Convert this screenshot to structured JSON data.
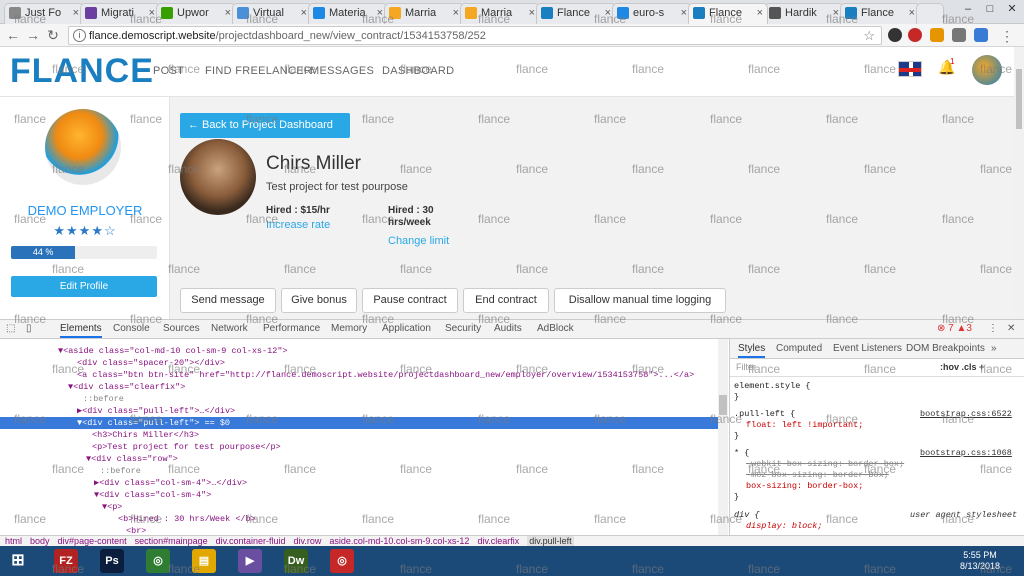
{
  "tabs": [
    {
      "label": "Just Fo",
      "color": "#888"
    },
    {
      "label": "Migrati",
      "color": "#6b3fa0"
    },
    {
      "label": "Upwor",
      "color": "#37a000"
    },
    {
      "label": "Virtual",
      "color": "#4a90d9"
    },
    {
      "label": "Materia",
      "color": "#1e88e5"
    },
    {
      "label": "Marria",
      "color": "#f5a623"
    },
    {
      "label": "Marria",
      "color": "#f5a623"
    },
    {
      "label": "Flance",
      "color": "#1a7fc1"
    },
    {
      "label": "euro-s",
      "color": "#1e88e5"
    },
    {
      "label": "Flance",
      "color": "#1a7fc1"
    },
    {
      "label": "Hardik",
      "color": "#555"
    },
    {
      "label": "Flance",
      "color": "#1a7fc1"
    }
  ],
  "address": {
    "host": "flance.demoscript.website",
    "path": "/projectdashboard_new/view_contract/1534153758/252"
  },
  "site": {
    "logo": "FLANCE",
    "nav": [
      "POST",
      "FIND FREELANCER",
      "MESSAGES",
      "DASHBOARD"
    ],
    "notification_count": "1"
  },
  "sidebar": {
    "name": "DEMO EMPLOYER",
    "stars": "★★★★☆",
    "progress_label": "44 %",
    "progress": 44,
    "edit_profile": "Edit Profile"
  },
  "main": {
    "back_button": "← Back to Project Dashboard",
    "freelancer_name": "Chirs Miller",
    "description": "Test project for test pourpose",
    "hired_rate": "Hired : $15/hr",
    "increase_rate": "Increase rate",
    "hired_hours": "Hired : 30 hrs/week",
    "change_limit": "Change limit",
    "actions": [
      "Send message",
      "Give bonus",
      "Pause contract",
      "End contract",
      "Disallow manual time logging"
    ]
  },
  "devtools": {
    "tabs": [
      "Elements",
      "Console",
      "Sources",
      "Network",
      "Performance",
      "Memory",
      "Application",
      "Security",
      "Audits",
      "AdBlock"
    ],
    "errors": "⊗ 7 ▲3",
    "dom_lines": [
      "▼<aside class=\"col-md-10 col-sm-9 col-xs-12\">",
      "<div class=\"spacer-20\"></div>",
      "<a class=\"btn btn-site\" href=\"http://flance.demoscript.website/projectdashboard_new/employer/overview/1534153758\">...</a>",
      "▼<div class=\"clearfix\">",
      "::before",
      "▶<div class=\"pull-left\">…</div>",
      "▼<div class=\"pull-left\"> == $0",
      "<h3>Chirs Miller</h3>",
      "<p>Test project for test pourpose</p>",
      "▼<div class=\"row\">",
      "::before",
      "▶<div class=\"col-sm-4\">…</div>",
      "▼<div class=\"col-sm-4\">",
      "▼<p>",
      "<b>Hired : 30 hrs/Week </b>",
      "<br>"
    ],
    "styles_tabs": [
      "Styles",
      "Computed",
      "Event Listeners",
      "DOM Breakpoints"
    ],
    "filter_placeholder": "Filter",
    "filter_hov": ":hov  .cls  +",
    "rules": [
      {
        "selector": "element.style {",
        "source": "",
        "props": [
          "}"
        ]
      },
      {
        "selector": ".pull-left {",
        "source": "bootstrap.css:6522",
        "props": [
          "float: left !important;",
          "}"
        ]
      },
      {
        "selector": "* {",
        "source": "bootstrap.css:1068",
        "props": [
          "-webkit-box-sizing: border-box;",
          "-moz-box-sizing: border-box;",
          "box-sizing: border-box;",
          "}"
        ]
      },
      {
        "selector": "div {",
        "source": "user agent stylesheet",
        "props": [
          "display: block;"
        ]
      }
    ],
    "breadcrumb": [
      "html",
      "body",
      "div#page-content",
      "section#mainpage",
      "div.container-fluid",
      "div.row",
      "aside.col-md-10.col-sm-9.col-xs-12",
      "div.clearfix",
      "div.pull-left"
    ]
  },
  "taskbar": {
    "apps": [
      {
        "name": "filezilla",
        "label": "FZ",
        "color": "#b22222"
      },
      {
        "name": "photoshop",
        "label": "Ps",
        "color": "#0b1e3d"
      },
      {
        "name": "chrome",
        "label": "◎",
        "color": "#2e7d32"
      },
      {
        "name": "explorer",
        "label": "▤",
        "color": "#e0a800"
      },
      {
        "name": "media",
        "label": "▶",
        "color": "#6a4fa0"
      },
      {
        "name": "dreamweaver",
        "label": "Dw",
        "color": "#355e1f"
      },
      {
        "name": "chrome2",
        "label": "◎",
        "color": "#c62828"
      }
    ],
    "time": "5:55 PM",
    "date": "8/13/2018"
  },
  "watermark": "flance"
}
